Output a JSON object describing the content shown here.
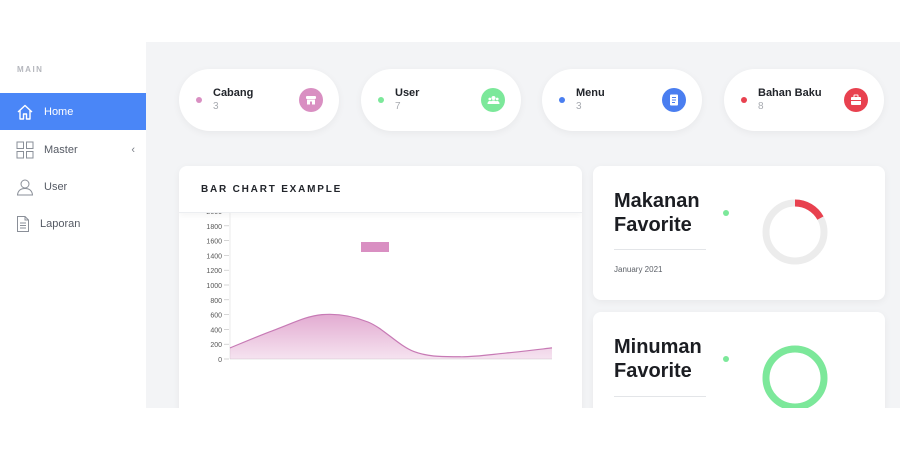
{
  "sidebar": {
    "section_label": "MAIN",
    "items": [
      {
        "label": "Home",
        "icon": "home-icon",
        "active": true
      },
      {
        "label": "Master",
        "icon": "grid-icon",
        "active": false,
        "chevron": "‹"
      },
      {
        "label": "User",
        "icon": "user-icon",
        "active": false
      },
      {
        "label": "Laporan",
        "icon": "document-icon",
        "active": false
      }
    ]
  },
  "stats": [
    {
      "label": "Cabang",
      "count": "3",
      "color": "#d98fc2",
      "icon": "store-icon"
    },
    {
      "label": "User",
      "count": "7",
      "color": "#7ce89a",
      "icon": "users-icon"
    },
    {
      "label": "Menu",
      "count": "3",
      "color": "#4a7ef0",
      "icon": "book-icon"
    },
    {
      "label": "Bahan Baku",
      "count": "8",
      "color": "#e8414f",
      "icon": "box-icon"
    }
  ],
  "chart_card": {
    "title": "BAR CHART EXAMPLE"
  },
  "chart_data": {
    "type": "area",
    "title": "",
    "xlabel": "",
    "ylabel": "",
    "ylim": [
      0,
      2000
    ],
    "yticks": [
      "2000",
      "1800",
      "1600",
      "1400",
      "1200",
      "1000",
      "800",
      "600",
      "400",
      "200",
      "0"
    ],
    "legend": "top",
    "series": [
      {
        "color": "#d98fc2",
        "values": [
          150,
          400,
          600,
          500,
          100,
          30,
          80,
          150
        ]
      }
    ]
  },
  "favorites": [
    {
      "title_line1": "Makanan",
      "title_line2": "Favorite",
      "date": "January 2021",
      "ring_color": "#e8414f",
      "ring_value": 0.17
    },
    {
      "title_line1": "Minuman",
      "title_line2": "Favorite",
      "date": "",
      "ring_color": "#7ce89a",
      "ring_value": 1.0
    }
  ],
  "colors": {
    "accent": "#4a86f7",
    "background": "#f3f4f6",
    "ring_track": "#ececec"
  }
}
